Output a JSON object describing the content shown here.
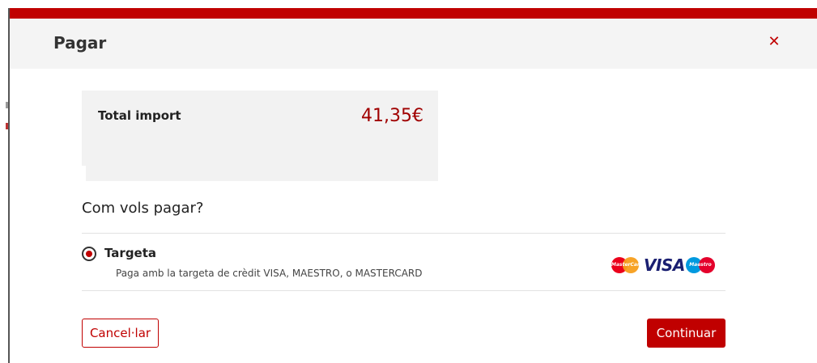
{
  "modal": {
    "title": "Pagar",
    "close_icon": "close-icon"
  },
  "summary": {
    "total_label": "Total import",
    "total_amount": "41,35€"
  },
  "payment": {
    "question": "Com vols pagar?",
    "options": [
      {
        "label": "Targeta",
        "description": "Paga amb la targeta de crèdit VISA, MAESTRO, o MASTERCARD",
        "selected": true,
        "card_logos": {
          "mastercard": "MasterCard",
          "visa": "VISA",
          "maestro": "Maestro"
        }
      }
    ]
  },
  "actions": {
    "cancel_label": "Cancel·lar",
    "continue_label": "Continuar"
  },
  "colors": {
    "brand_red": "#c00000",
    "amount_red": "#a00000",
    "header_bg": "#f4f4f4",
    "summary_bg": "#f2f2f2"
  }
}
